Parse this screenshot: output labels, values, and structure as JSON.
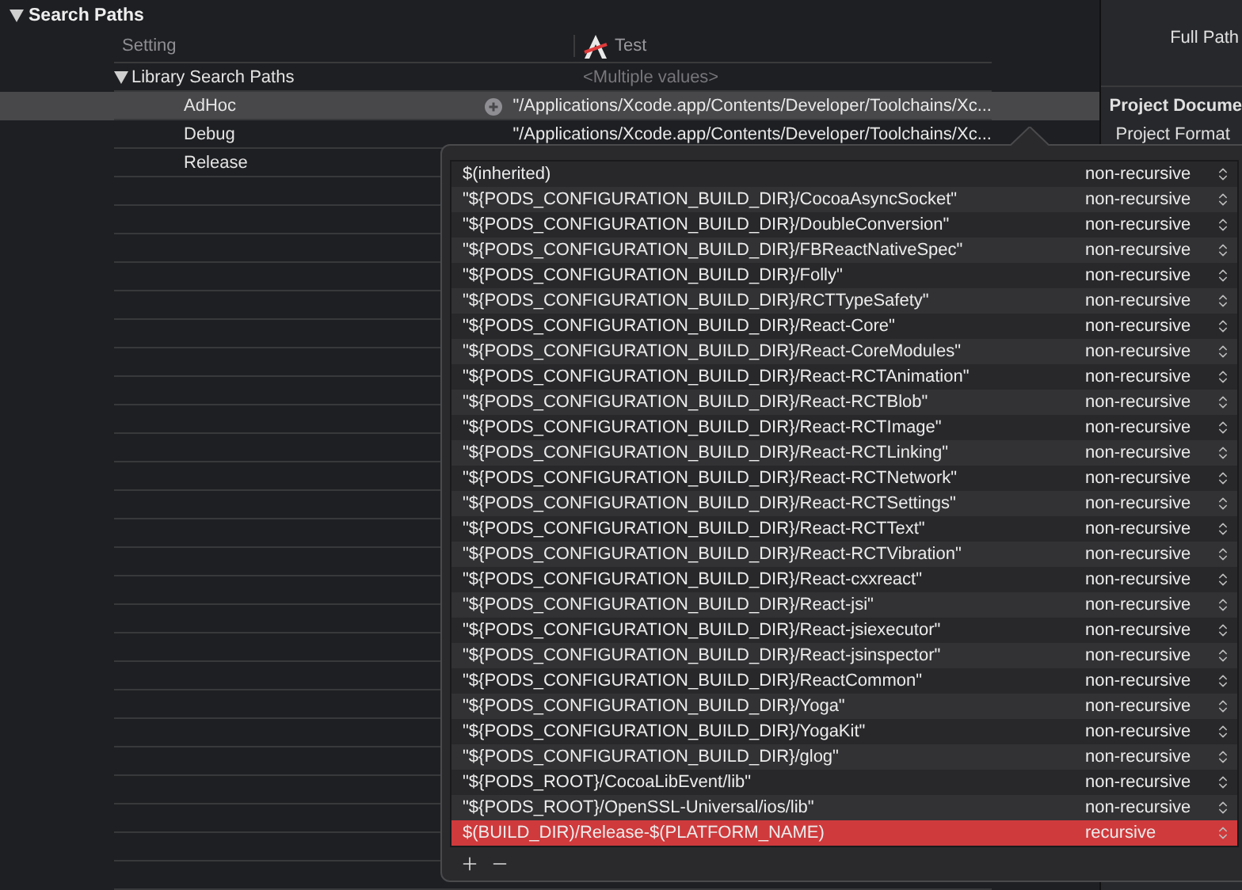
{
  "section": {
    "title": "Search Paths",
    "expanded": true
  },
  "columns": {
    "setting": "Setting",
    "target": "Test"
  },
  "setting": {
    "name": "Library Search Paths",
    "expanded": true,
    "value": "<Multiple values>",
    "configs": [
      {
        "name": "AdHoc",
        "value": "\"/Applications/Xcode.app/Contents/Developer/Toolchains/Xc...",
        "selected": true
      },
      {
        "name": "Debug",
        "value": "\"/Applications/Xcode.app/Contents/Developer/Toolchains/Xc...",
        "selected": false
      },
      {
        "name": "Release",
        "selected": false
      }
    ]
  },
  "inspector": {
    "full_path_label": "Full Path",
    "section_title": "Project Docume",
    "format_label": "Project Format"
  },
  "popover": {
    "paths": [
      {
        "path": "$(inherited)",
        "recursion": "non-recursive",
        "selected": false
      },
      {
        "path": "\"${PODS_CONFIGURATION_BUILD_DIR}/CocoaAsyncSocket\"",
        "recursion": "non-recursive",
        "selected": false
      },
      {
        "path": "\"${PODS_CONFIGURATION_BUILD_DIR}/DoubleConversion\"",
        "recursion": "non-recursive",
        "selected": false
      },
      {
        "path": "\"${PODS_CONFIGURATION_BUILD_DIR}/FBReactNativeSpec\"",
        "recursion": "non-recursive",
        "selected": false
      },
      {
        "path": "\"${PODS_CONFIGURATION_BUILD_DIR}/Folly\"",
        "recursion": "non-recursive",
        "selected": false
      },
      {
        "path": "\"${PODS_CONFIGURATION_BUILD_DIR}/RCTTypeSafety\"",
        "recursion": "non-recursive",
        "selected": false
      },
      {
        "path": "\"${PODS_CONFIGURATION_BUILD_DIR}/React-Core\"",
        "recursion": "non-recursive",
        "selected": false
      },
      {
        "path": "\"${PODS_CONFIGURATION_BUILD_DIR}/React-CoreModules\"",
        "recursion": "non-recursive",
        "selected": false
      },
      {
        "path": "\"${PODS_CONFIGURATION_BUILD_DIR}/React-RCTAnimation\"",
        "recursion": "non-recursive",
        "selected": false
      },
      {
        "path": "\"${PODS_CONFIGURATION_BUILD_DIR}/React-RCTBlob\"",
        "recursion": "non-recursive",
        "selected": false
      },
      {
        "path": "\"${PODS_CONFIGURATION_BUILD_DIR}/React-RCTImage\"",
        "recursion": "non-recursive",
        "selected": false
      },
      {
        "path": "\"${PODS_CONFIGURATION_BUILD_DIR}/React-RCTLinking\"",
        "recursion": "non-recursive",
        "selected": false
      },
      {
        "path": "\"${PODS_CONFIGURATION_BUILD_DIR}/React-RCTNetwork\"",
        "recursion": "non-recursive",
        "selected": false
      },
      {
        "path": "\"${PODS_CONFIGURATION_BUILD_DIR}/React-RCTSettings\"",
        "recursion": "non-recursive",
        "selected": false
      },
      {
        "path": "\"${PODS_CONFIGURATION_BUILD_DIR}/React-RCTText\"",
        "recursion": "non-recursive",
        "selected": false
      },
      {
        "path": "\"${PODS_CONFIGURATION_BUILD_DIR}/React-RCTVibration\"",
        "recursion": "non-recursive",
        "selected": false
      },
      {
        "path": "\"${PODS_CONFIGURATION_BUILD_DIR}/React-cxxreact\"",
        "recursion": "non-recursive",
        "selected": false
      },
      {
        "path": "\"${PODS_CONFIGURATION_BUILD_DIR}/React-jsi\"",
        "recursion": "non-recursive",
        "selected": false
      },
      {
        "path": "\"${PODS_CONFIGURATION_BUILD_DIR}/React-jsiexecutor\"",
        "recursion": "non-recursive",
        "selected": false
      },
      {
        "path": "\"${PODS_CONFIGURATION_BUILD_DIR}/React-jsinspector\"",
        "recursion": "non-recursive",
        "selected": false
      },
      {
        "path": "\"${PODS_CONFIGURATION_BUILD_DIR}/ReactCommon\"",
        "recursion": "non-recursive",
        "selected": false
      },
      {
        "path": "\"${PODS_CONFIGURATION_BUILD_DIR}/Yoga\"",
        "recursion": "non-recursive",
        "selected": false
      },
      {
        "path": "\"${PODS_CONFIGURATION_BUILD_DIR}/YogaKit\"",
        "recursion": "non-recursive",
        "selected": false
      },
      {
        "path": "\"${PODS_CONFIGURATION_BUILD_DIR}/glog\"",
        "recursion": "non-recursive",
        "selected": false
      },
      {
        "path": "\"${PODS_ROOT}/CocoaLibEvent/lib\"",
        "recursion": "non-recursive",
        "selected": false
      },
      {
        "path": "\"${PODS_ROOT}/OpenSSL-Universal/ios/lib\"",
        "recursion": "non-recursive",
        "selected": false
      },
      {
        "path": "$(BUILD_DIR)/Release-$(PLATFORM_NAME)",
        "recursion": "recursive",
        "selected": true
      }
    ]
  }
}
